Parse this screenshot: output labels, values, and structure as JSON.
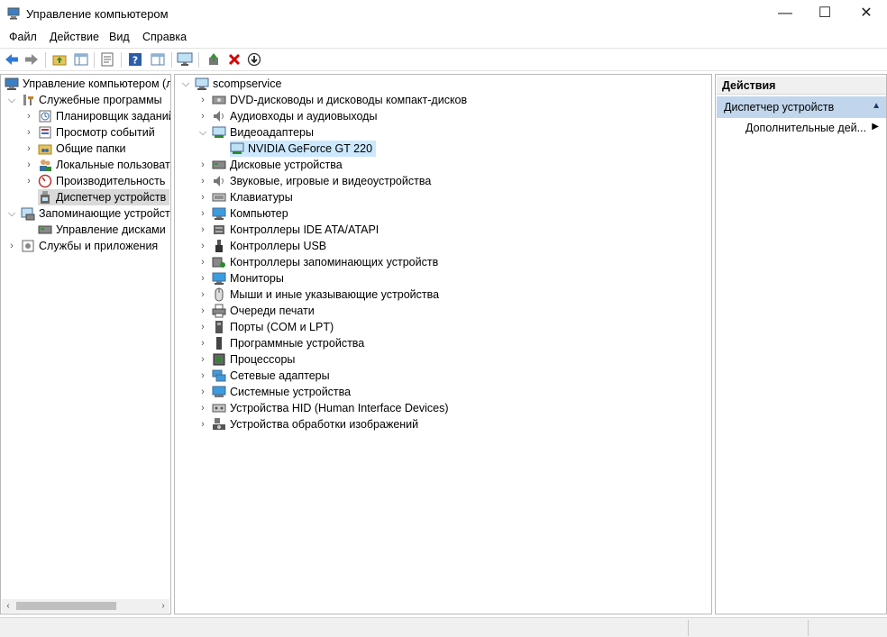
{
  "window": {
    "title": "Управление компьютером",
    "minimize_glyph": "—",
    "maximize_glyph": "☐",
    "close_glyph": "✕"
  },
  "menu": [
    "Файл",
    "Действие",
    "Вид",
    "Справка"
  ],
  "toolbar": {
    "icons": [
      "back-arrow-icon",
      "forward-arrow-icon",
      "up-folder-icon",
      "show-hide-tree-icon",
      "properties-icon",
      "help-icon",
      "show-hide-action-pane-icon",
      "monitor-icon",
      "update-driver-icon",
      "uninstall-icon",
      "disable-device-icon"
    ]
  },
  "left_tree": {
    "root": "Управление компьютером (л",
    "items": [
      {
        "label": "Служебные программы",
        "level": 1,
        "expanded": true
      },
      {
        "label": "Планировщик заданий",
        "level": 2
      },
      {
        "label": "Просмотр событий",
        "level": 2
      },
      {
        "label": "Общие папки",
        "level": 2
      },
      {
        "label": "Локальные пользовате",
        "level": 2
      },
      {
        "label": "Производительность",
        "level": 2
      },
      {
        "label": "Диспетчер устройств",
        "level": 2,
        "selected": true
      },
      {
        "label": "Запоминающие устройст",
        "level": 1,
        "expanded": true
      },
      {
        "label": "Управление дисками",
        "level": 2
      },
      {
        "label": "Службы и приложения",
        "level": 1
      }
    ]
  },
  "device_tree": {
    "root": "scompservice",
    "items": [
      {
        "label": "DVD-дисководы и дисководы компакт-дисков",
        "icon": "dvd-drive-icon"
      },
      {
        "label": "Аудиовходы и аудиовыходы",
        "icon": "speaker-icon"
      },
      {
        "label": "Видеоадаптеры",
        "icon": "display-adapter-icon",
        "expanded": true
      },
      {
        "label": "NVIDIA GeForce GT 220",
        "icon": "display-adapter-icon",
        "child": true,
        "selected": true
      },
      {
        "label": "Дисковые устройства",
        "icon": "disk-drive-icon"
      },
      {
        "label": "Звуковые, игровые и видеоустройства",
        "icon": "speaker-icon"
      },
      {
        "label": "Клавиатуры",
        "icon": "keyboard-icon"
      },
      {
        "label": "Компьютер",
        "icon": "computer-icon"
      },
      {
        "label": "Контроллеры IDE ATA/ATAPI",
        "icon": "ide-controller-icon"
      },
      {
        "label": "Контроллеры USB",
        "icon": "usb-icon"
      },
      {
        "label": "Контроллеры запоминающих устройств",
        "icon": "storage-controller-icon"
      },
      {
        "label": "Мониторы",
        "icon": "monitor-icon"
      },
      {
        "label": "Мыши и иные указывающие устройства",
        "icon": "mouse-icon"
      },
      {
        "label": "Очереди печати",
        "icon": "printer-icon"
      },
      {
        "label": "Порты (COM и LPT)",
        "icon": "port-icon"
      },
      {
        "label": "Программные устройства",
        "icon": "software-device-icon"
      },
      {
        "label": "Процессоры",
        "icon": "processor-icon"
      },
      {
        "label": "Сетевые адаптеры",
        "icon": "network-adapter-icon"
      },
      {
        "label": "Системные устройства",
        "icon": "system-device-icon"
      },
      {
        "label": "Устройства HID (Human Interface Devices)",
        "icon": "hid-icon"
      },
      {
        "label": "Устройства обработки изображений",
        "icon": "camera-icon"
      }
    ]
  },
  "actions": {
    "header": "Действия",
    "section": "Диспетчер устройств",
    "item": "Дополнительные дей..."
  },
  "colors": {
    "selection_blue": "#cce8ff",
    "section_blue": "#c1d6ec",
    "uninstall_red": "#d40000",
    "help_blue": "#2a5caa"
  }
}
